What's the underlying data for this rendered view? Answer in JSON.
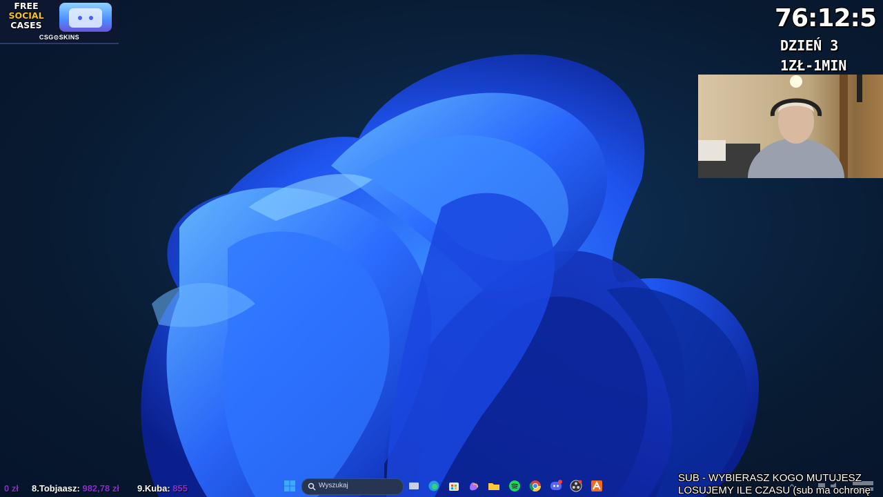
{
  "overlay": {
    "promo": {
      "title_lines": [
        "FREE",
        "SOCIAL",
        "CASES"
      ],
      "brand": "CSG⊙SKINS"
    },
    "timer": "76:12:5",
    "day_label": "DZIEŃ 3",
    "rate_label": "1ZŁ-1MIN",
    "notice_lines": [
      "SUB - WYBIERASZ KOGO MUTUJESZ",
      "LOSUJEMY ILE CZASU (sub ma ochronę"
    ]
  },
  "leaderboard": [
    {
      "rank_name": "",
      "amount": "0 zł"
    },
    {
      "rank_name": "8.Tobjaasz:",
      "amount": "982,78 zł"
    },
    {
      "rank_name": "9.Kuba:",
      "amount": "855"
    }
  ],
  "taskbar": {
    "search_placeholder": "Wyszukaj",
    "icons": [
      "windows-start-icon",
      "file-explorer-icon",
      "edge-icon",
      "store-icon",
      "copilot-icon",
      "folder-icon",
      "spotify-icon",
      "chrome-icon",
      "discord-icon",
      "obs-icon",
      "app-icon"
    ]
  },
  "colors": {
    "accent": "#1e5bff",
    "leaderboard_amount": "#8a2be2",
    "taskbar": "#1c2a45"
  }
}
